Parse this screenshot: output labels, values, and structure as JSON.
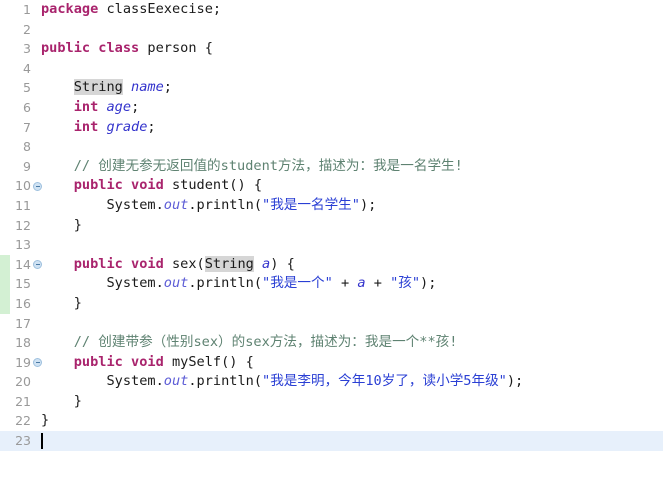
{
  "editor": {
    "language": "java",
    "theme_colors": {
      "background": "#ffffff",
      "gutter_text": "#999999",
      "keyword": "#a9246d",
      "string": "#2a3fd4",
      "comment": "#5e8271",
      "field": "#3333cc",
      "static_field": "#5c5cd6",
      "current_line_highlight": "#e7f0fb",
      "identifier_highlight": "#d6d6d6",
      "vcs_changed_stripe": "#d3f0d3",
      "fold_marker": "#cfe2f3"
    },
    "caret": {
      "line": 23,
      "column": 1
    },
    "vcs_changed_lines": [
      14,
      15,
      16
    ],
    "fold_marker_lines": [
      10,
      14,
      19
    ],
    "lines": [
      {
        "n": "1",
        "tokens": [
          {
            "t": "package",
            "c": "kw"
          },
          {
            "t": " ",
            "c": "op"
          },
          {
            "t": "classEexecise",
            "c": "ident"
          },
          {
            "t": ";",
            "c": "op"
          }
        ]
      },
      {
        "n": "2",
        "tokens": []
      },
      {
        "n": "3",
        "tokens": [
          {
            "t": "public",
            "c": "kw"
          },
          {
            "t": " ",
            "c": "op"
          },
          {
            "t": "class",
            "c": "kw"
          },
          {
            "t": " ",
            "c": "op"
          },
          {
            "t": "person",
            "c": "type"
          },
          {
            "t": " {",
            "c": "op"
          }
        ]
      },
      {
        "n": "4",
        "tokens": []
      },
      {
        "n": "5",
        "tokens": [
          {
            "t": "    ",
            "c": "op"
          },
          {
            "t": "String",
            "c": "type hl"
          },
          {
            "t": " ",
            "c": "op"
          },
          {
            "t": "name",
            "c": "field"
          },
          {
            "t": ";",
            "c": "op"
          }
        ]
      },
      {
        "n": "6",
        "tokens": [
          {
            "t": "    ",
            "c": "op"
          },
          {
            "t": "int",
            "c": "kw"
          },
          {
            "t": " ",
            "c": "op"
          },
          {
            "t": "age",
            "c": "field"
          },
          {
            "t": ";",
            "c": "op"
          }
        ]
      },
      {
        "n": "7",
        "tokens": [
          {
            "t": "    ",
            "c": "op"
          },
          {
            "t": "int",
            "c": "kw"
          },
          {
            "t": " ",
            "c": "op"
          },
          {
            "t": "grade",
            "c": "field"
          },
          {
            "t": ";",
            "c": "op"
          }
        ]
      },
      {
        "n": "8",
        "tokens": []
      },
      {
        "n": "9",
        "tokens": [
          {
            "t": "    ",
            "c": "op"
          },
          {
            "t": "// 创建无参无返回值的student方法，描述为：我是一名学生!",
            "c": "cmt"
          }
        ]
      },
      {
        "n": "10",
        "tokens": [
          {
            "t": "    ",
            "c": "op"
          },
          {
            "t": "public",
            "c": "kw"
          },
          {
            "t": " ",
            "c": "op"
          },
          {
            "t": "void",
            "c": "kw"
          },
          {
            "t": " ",
            "c": "op"
          },
          {
            "t": "student",
            "c": "type"
          },
          {
            "t": "() {",
            "c": "op"
          }
        ]
      },
      {
        "n": "11",
        "tokens": [
          {
            "t": "        ",
            "c": "op"
          },
          {
            "t": "System",
            "c": "ident"
          },
          {
            "t": ".",
            "c": "op"
          },
          {
            "t": "out",
            "c": "stat"
          },
          {
            "t": ".println(",
            "c": "op"
          },
          {
            "t": "\"我是一名学生\"",
            "c": "str"
          },
          {
            "t": ");",
            "c": "op"
          }
        ]
      },
      {
        "n": "12",
        "tokens": [
          {
            "t": "    }",
            "c": "op"
          }
        ]
      },
      {
        "n": "13",
        "tokens": []
      },
      {
        "n": "14",
        "tokens": [
          {
            "t": "    ",
            "c": "op"
          },
          {
            "t": "public",
            "c": "kw"
          },
          {
            "t": " ",
            "c": "op"
          },
          {
            "t": "void",
            "c": "kw"
          },
          {
            "t": " ",
            "c": "op"
          },
          {
            "t": "sex",
            "c": "type"
          },
          {
            "t": "(",
            "c": "op"
          },
          {
            "t": "String",
            "c": "type hl"
          },
          {
            "t": " ",
            "c": "op"
          },
          {
            "t": "a",
            "c": "field"
          },
          {
            "t": ") {",
            "c": "op"
          }
        ]
      },
      {
        "n": "15",
        "tokens": [
          {
            "t": "        ",
            "c": "op"
          },
          {
            "t": "System",
            "c": "ident"
          },
          {
            "t": ".",
            "c": "op"
          },
          {
            "t": "out",
            "c": "stat"
          },
          {
            "t": ".println(",
            "c": "op"
          },
          {
            "t": "\"我是一个\"",
            "c": "str"
          },
          {
            "t": " + ",
            "c": "op"
          },
          {
            "t": "a",
            "c": "field"
          },
          {
            "t": " + ",
            "c": "op"
          },
          {
            "t": "\"孩\"",
            "c": "str"
          },
          {
            "t": ");",
            "c": "op"
          }
        ]
      },
      {
        "n": "16",
        "tokens": [
          {
            "t": "    }",
            "c": "op"
          }
        ]
      },
      {
        "n": "17",
        "tokens": []
      },
      {
        "n": "18",
        "tokens": [
          {
            "t": "    ",
            "c": "op"
          },
          {
            "t": "// 创建带参（性别sex）的sex方法，描述为：我是一个**孩!",
            "c": "cmt"
          }
        ]
      },
      {
        "n": "19",
        "tokens": [
          {
            "t": "    ",
            "c": "op"
          },
          {
            "t": "public",
            "c": "kw"
          },
          {
            "t": " ",
            "c": "op"
          },
          {
            "t": "void",
            "c": "kw"
          },
          {
            "t": " ",
            "c": "op"
          },
          {
            "t": "mySelf",
            "c": "type"
          },
          {
            "t": "() {",
            "c": "op"
          }
        ]
      },
      {
        "n": "20",
        "tokens": [
          {
            "t": "        ",
            "c": "op"
          },
          {
            "t": "System",
            "c": "ident"
          },
          {
            "t": ".",
            "c": "op"
          },
          {
            "t": "out",
            "c": "stat"
          },
          {
            "t": ".println(",
            "c": "op"
          },
          {
            "t": "\"我是李明，今年10岁了，读小学5年级\"",
            "c": "str"
          },
          {
            "t": ");",
            "c": "op"
          }
        ]
      },
      {
        "n": "21",
        "tokens": [
          {
            "t": "    }",
            "c": "op"
          }
        ]
      },
      {
        "n": "22",
        "tokens": [
          {
            "t": "}",
            "c": "op"
          }
        ]
      },
      {
        "n": "23",
        "tokens": []
      }
    ]
  }
}
